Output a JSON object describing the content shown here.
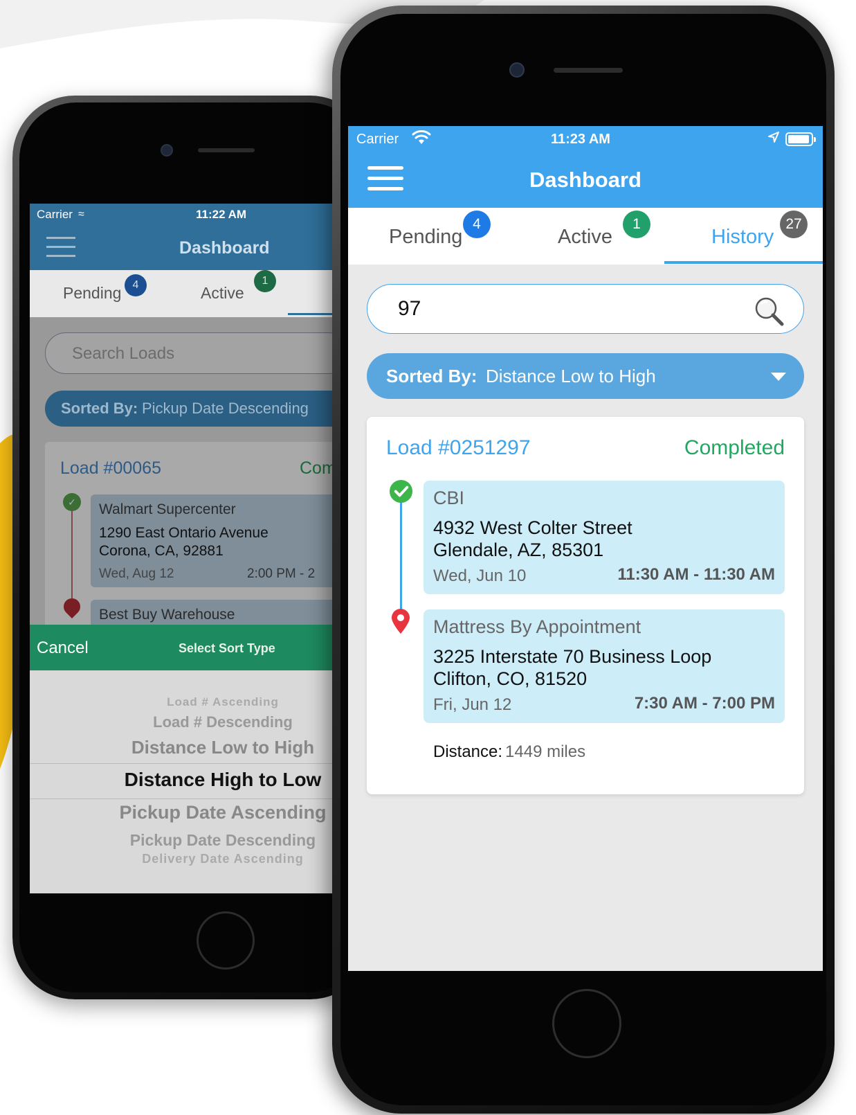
{
  "colors": {
    "primary": "#3ea4ee",
    "completed": "#20a862",
    "badge_pending": "#1e7be6",
    "badge_active": "#22a06b",
    "badge_history": "#666666",
    "stop_bg": "#cdedf9",
    "accent_yellow": "#f6be13"
  },
  "back_phone": {
    "status": {
      "carrier": "Carrier",
      "time": "11:22 AM"
    },
    "title": "Dashboard",
    "tabs": [
      {
        "label": "Pending",
        "badge": "4"
      },
      {
        "label": "Active",
        "badge": "1"
      }
    ],
    "search_placeholder": "Search Loads",
    "sort": {
      "label": "Sorted By:",
      "value": "Pickup Date Descending"
    },
    "card": {
      "load": "Load #00065",
      "status": "Com",
      "stops": [
        {
          "name": "Walmart Supercenter",
          "address_line1": "1290 East Ontario Avenue",
          "address_line2": "Corona, CA, 92881",
          "date": "Wed, Aug 12",
          "window": "2:00 PM - 2"
        },
        {
          "name": "Best Buy Warehouse"
        }
      ]
    },
    "picker": {
      "cancel": "Cancel",
      "title": "Select Sort Type",
      "options": [
        "Load # Ascending",
        "Load # Descending",
        "Distance Low to High",
        "Distance High to Low",
        "Pickup Date Ascending",
        "Pickup Date Descending",
        "Delivery Date Ascending"
      ]
    }
  },
  "front_phone": {
    "status": {
      "carrier": "Carrier",
      "time": "11:23 AM"
    },
    "title": "Dashboard",
    "tabs": [
      {
        "label": "Pending",
        "badge": "4",
        "active": false
      },
      {
        "label": "Active",
        "badge": "1",
        "active": false
      },
      {
        "label": "History",
        "badge": "27",
        "active": true
      }
    ],
    "search": {
      "value": "97",
      "placeholder": "Search Loads"
    },
    "sort": {
      "label": "Sorted By:",
      "value": "Distance Low to High"
    },
    "card": {
      "load": "Load #0251297",
      "status": "Completed",
      "stops": [
        {
          "type": "pickup",
          "name": "CBI",
          "address_line1": "4932 West Colter Street",
          "address_line2": "Glendale, AZ, 85301",
          "date": "Wed, Jun 10",
          "window": "11:30 AM - 11:30 AM"
        },
        {
          "type": "delivery",
          "name": "Mattress By Appointment",
          "address_line1": "3225 Interstate 70 Business Loop",
          "address_line2": "Clifton, CO, 81520",
          "date": "Fri, Jun 12",
          "window": "7:30 AM - 7:00 PM"
        }
      ],
      "distance_label": "Distance:",
      "distance_value": "1449 miles"
    }
  }
}
